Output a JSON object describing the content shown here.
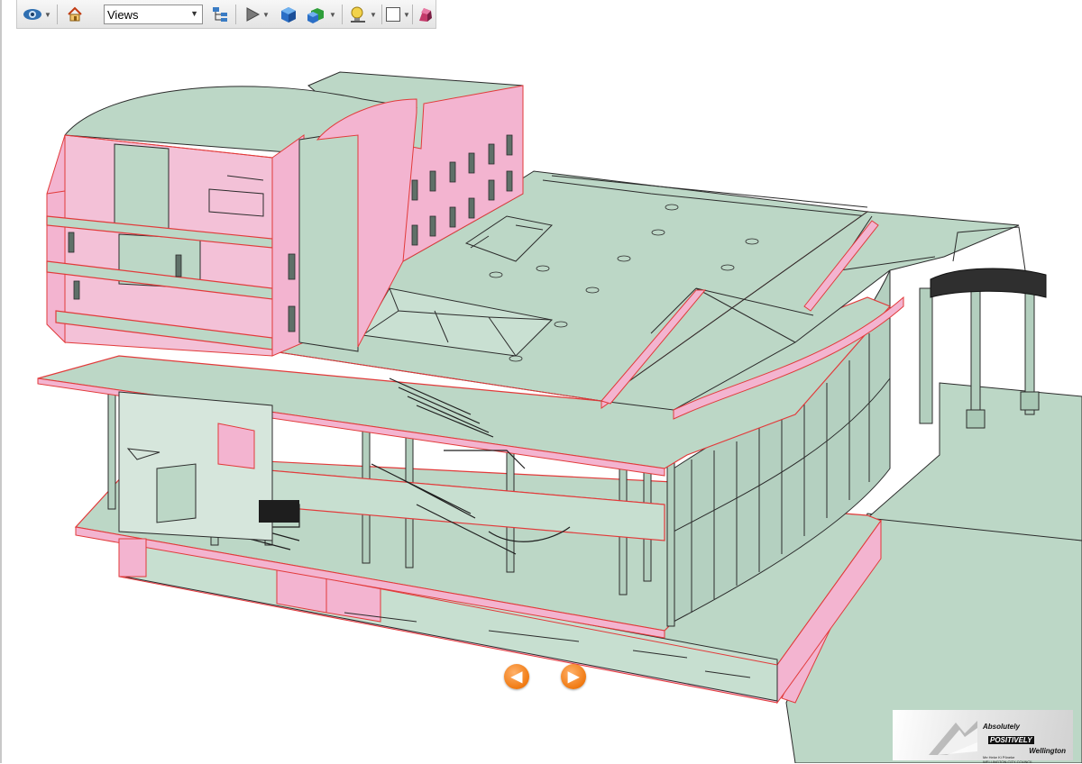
{
  "toolbar": {
    "views_label": "Views",
    "icons": [
      "navigation-mode-icon",
      "home-icon",
      "views-select",
      "model-tree-icon",
      "play-icon",
      "cube-icon",
      "multi-cube-icon",
      "lighting-icon",
      "background-color-icon",
      "section-icon"
    ]
  },
  "viewer": {
    "description_colors": {
      "surface": "#bcd7c6",
      "section_cut": "#f3b4d0",
      "edge": "#2b2b2b",
      "cut_edge": "#e23a3a"
    }
  },
  "navigation": {
    "prev_label": "◀",
    "next_label": "▶"
  },
  "logo": {
    "line1": "Absolutely",
    "line2": "POSITIVELY",
    "line3": "Wellington",
    "sub1": "Me Heke Ki Pōneke",
    "sub2": "WELLINGTON CITY COUNCIL"
  }
}
